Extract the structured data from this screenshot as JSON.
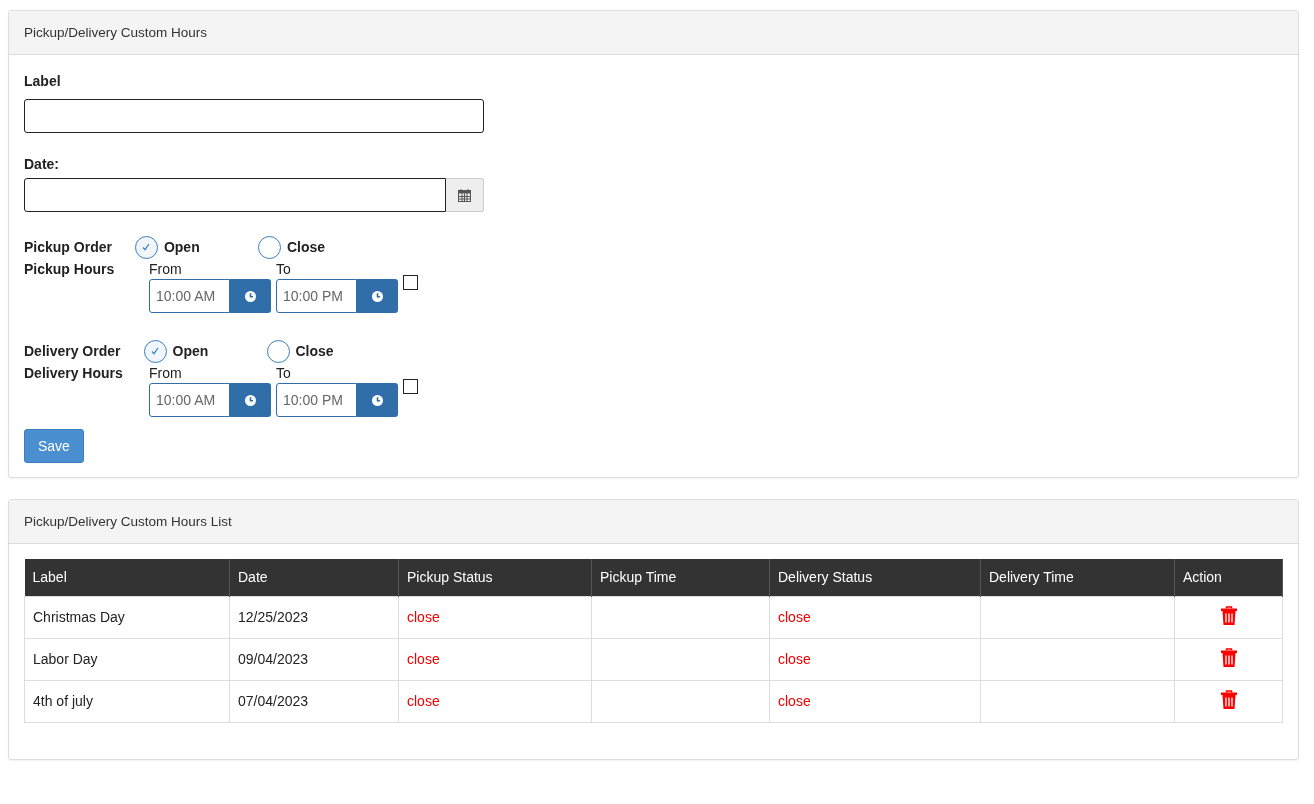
{
  "form_panel": {
    "title": "Pickup/Delivery Custom Hours"
  },
  "label_field": {
    "label": "Label"
  },
  "date_field": {
    "label": "Date:"
  },
  "sections": [
    {
      "order_label": "Pickup Order",
      "options": [
        {
          "label": "Open",
          "selected": true
        },
        {
          "label": "Close",
          "selected": false
        }
      ],
      "hours_label": "Pickup Hours",
      "from_label": "From",
      "from_value": "10:00 AM",
      "to_label": "To",
      "to_value": "10:00 PM",
      "checked": false
    },
    {
      "order_label": "Delivery Order",
      "options": [
        {
          "label": "Open",
          "selected": true
        },
        {
          "label": "Close",
          "selected": false
        }
      ],
      "hours_label": "Delivery Hours",
      "from_label": "From",
      "from_value": "10:00 AM",
      "to_label": "To",
      "to_value": "10:00 PM",
      "checked": false
    }
  ],
  "save_button": "Save",
  "list_panel": {
    "title": "Pickup/Delivery Custom Hours List"
  },
  "table": {
    "columns": [
      "Label",
      "Date",
      "Pickup Status",
      "Pickup Time",
      "Delivery Status",
      "Delivery Time",
      "Action"
    ],
    "rows": [
      {
        "label": "Christmas Day",
        "date": "12/25/2023",
        "pickup_status": "close",
        "delivery_status": "close"
      },
      {
        "label": "Labor Day",
        "date": "09/04/2023",
        "pickup_status": "close",
        "delivery_status": "close"
      },
      {
        "label": "4th of july",
        "date": "07/04/2023",
        "pickup_status": "close",
        "delivery_status": "close"
      }
    ]
  }
}
